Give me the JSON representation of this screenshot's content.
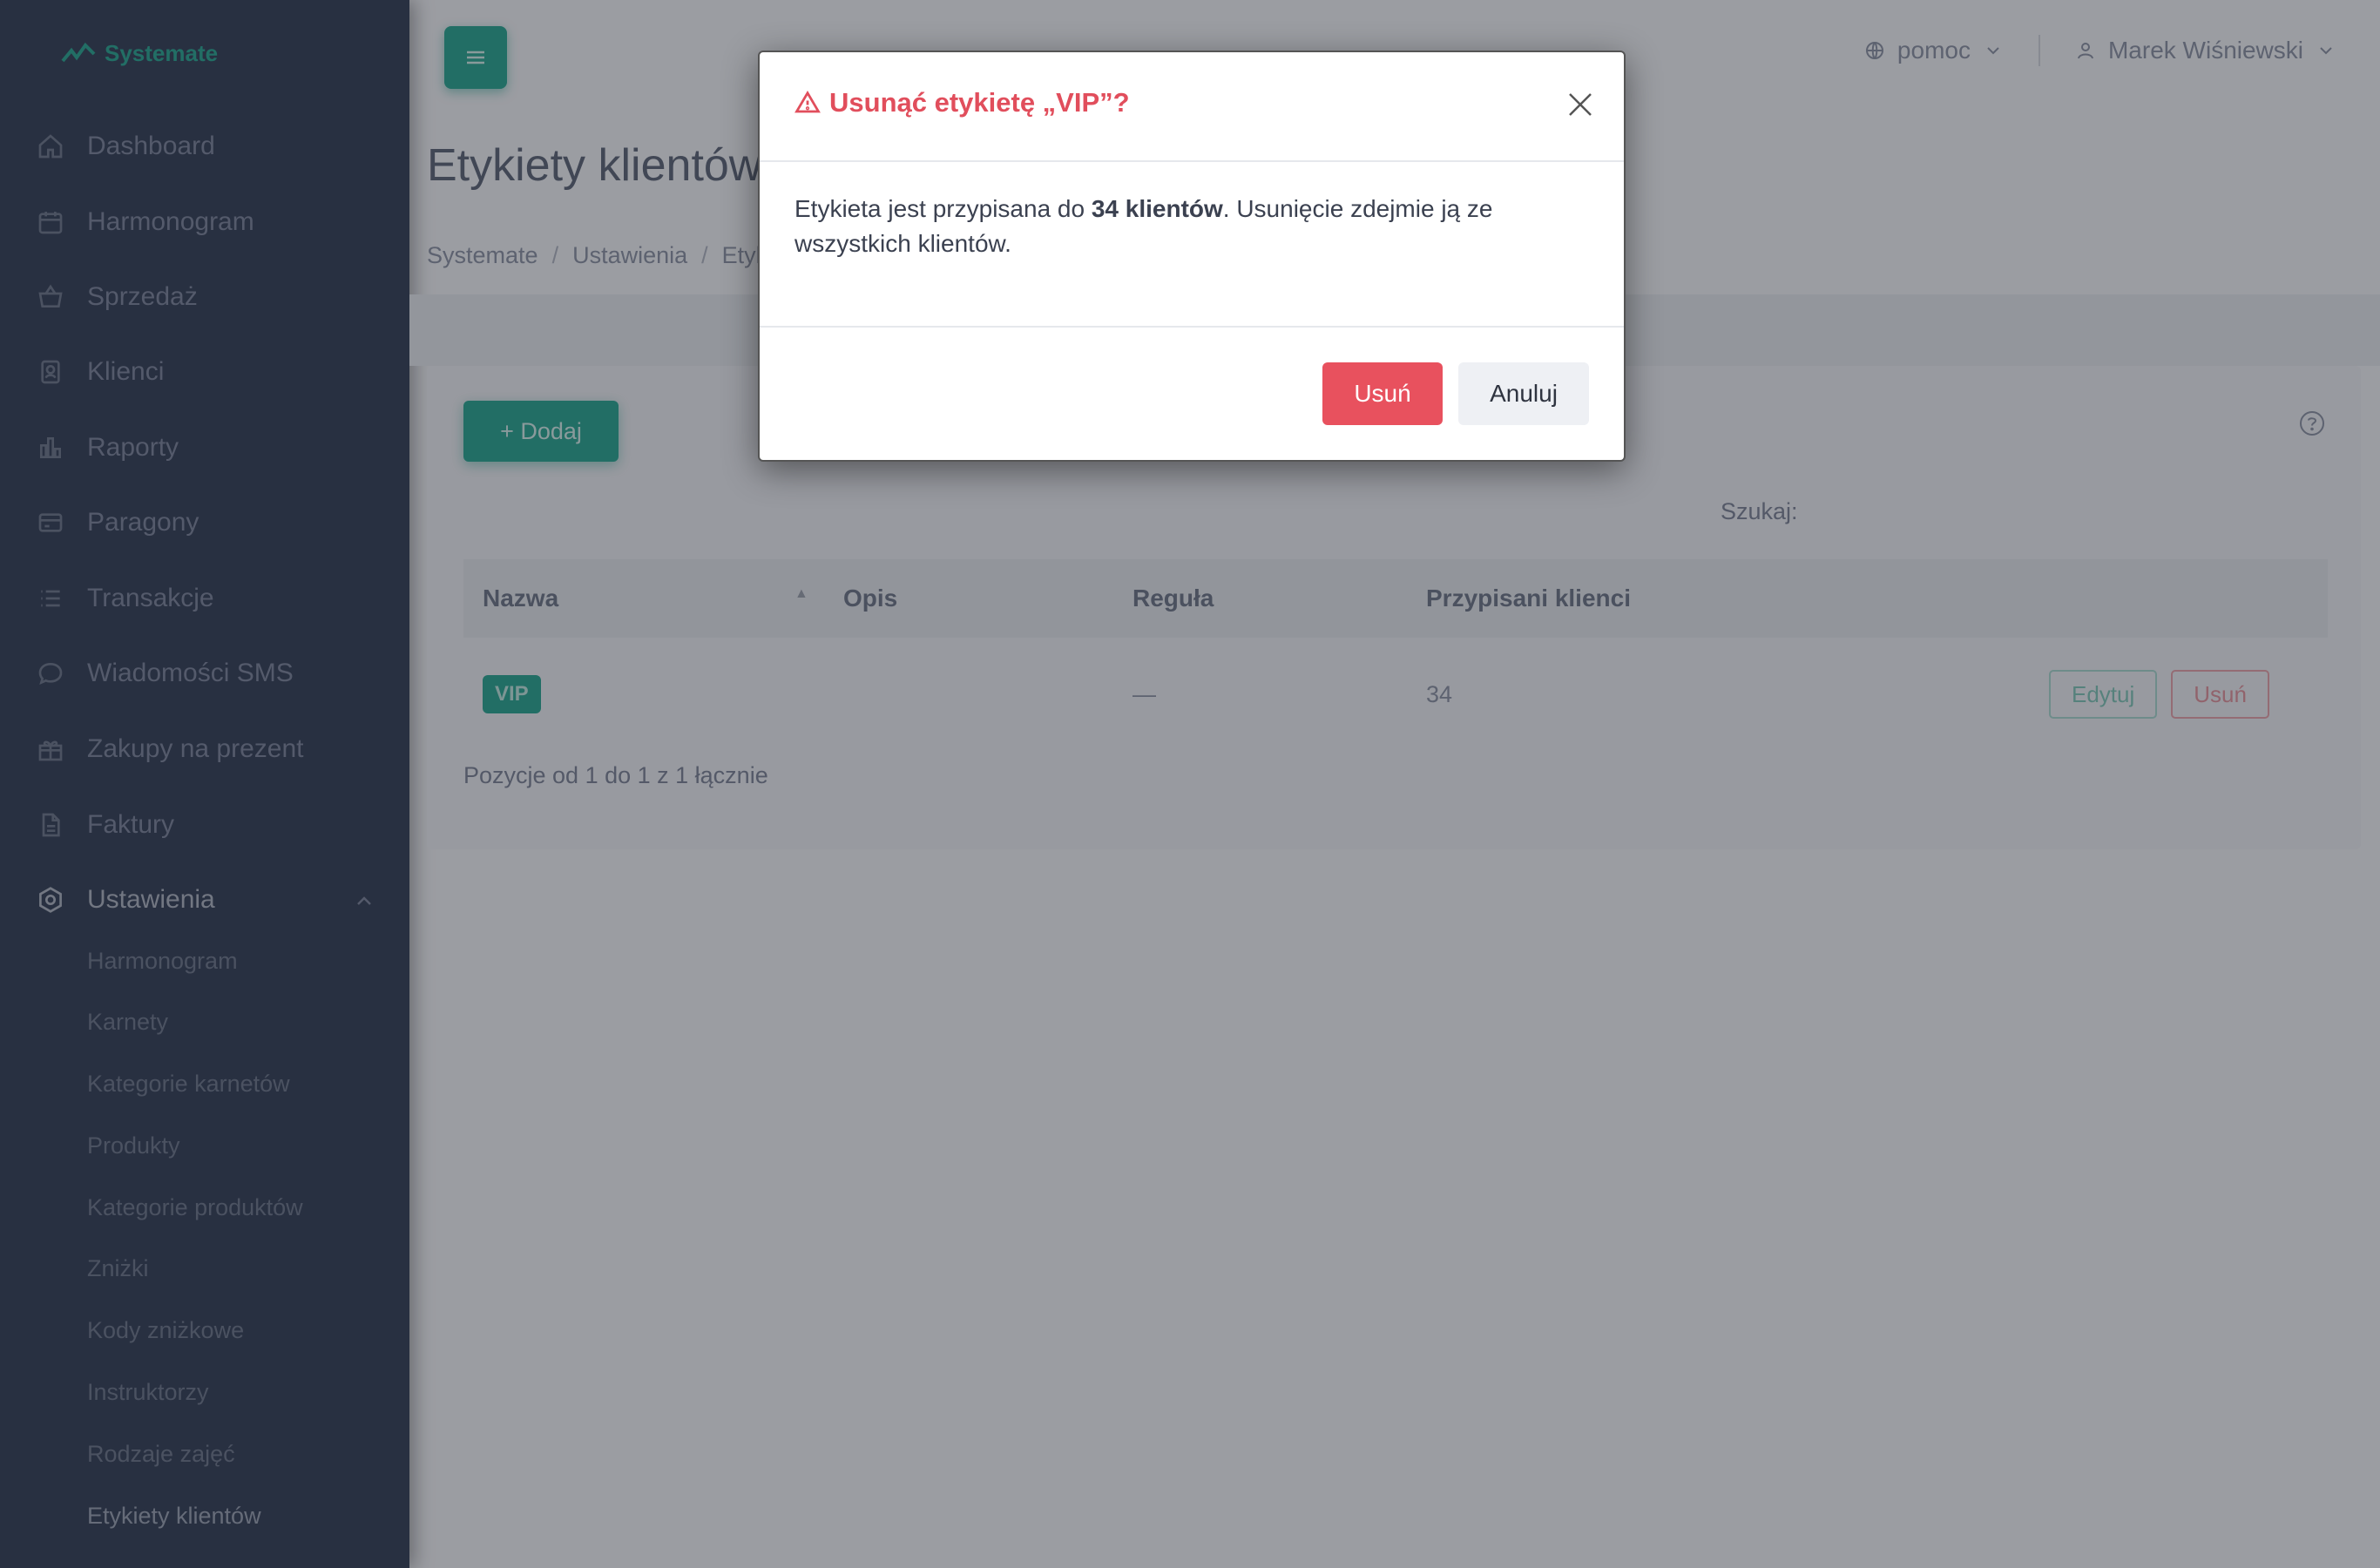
{
  "app": {
    "logo_text": "Systemate"
  },
  "sidebar": {
    "items": [
      {
        "label": "Dashboard",
        "icon": "home-icon"
      },
      {
        "label": "Harmonogram",
        "icon": "calendar-icon"
      },
      {
        "label": "Sprzedaż",
        "icon": "basket-icon"
      },
      {
        "label": "Klienci",
        "icon": "address-book-icon"
      },
      {
        "label": "Raporty",
        "icon": "bar-chart-icon"
      },
      {
        "label": "Paragony",
        "icon": "receipt-icon"
      },
      {
        "label": "Transakcje",
        "icon": "list-icon"
      },
      {
        "label": "Wiadomości SMS",
        "icon": "message-icon"
      },
      {
        "label": "Zakupy na prezent",
        "icon": "gift-icon"
      },
      {
        "label": "Faktury",
        "icon": "document-icon"
      },
      {
        "label": "Ustawienia",
        "icon": "gear-icon"
      }
    ],
    "settings_sub": [
      "Harmonogram",
      "Karnety",
      "Kategorie karnetów",
      "Produkty",
      "Kategorie produktów",
      "Zniżki",
      "Kody zniżkowe",
      "Instruktorzy",
      "Rodzaje zajęć",
      "Etykiety klientów"
    ]
  },
  "topbar": {
    "help_label": "pomoc",
    "user_name": "Marek Wiśniewski"
  },
  "page": {
    "title": "Etykiety klientów",
    "breadcrumb": [
      "Systemate",
      "Ustawienia",
      "Etykiety klientów"
    ]
  },
  "toolbar": {
    "add_label": "+ Dodaj",
    "search_label": "Szukaj:",
    "search_value": ""
  },
  "table": {
    "headers": [
      "Nazwa",
      "Opis",
      "Reguła",
      "Przypisani klienci"
    ],
    "rows": [
      {
        "name": "VIP",
        "description": "",
        "rule": "—",
        "assigned": "34",
        "edit_label": "Edytuj",
        "delete_label": "Usuń"
      }
    ],
    "info": "Pozycje od 1 do 1 z 1 łącznie"
  },
  "modal": {
    "title": "Usunąć etykietę „VIP”?",
    "body_prefix": "Etykieta jest przypisana do ",
    "body_bold": "34 klientów",
    "body_suffix": ". Usunięcie zdejmie ją ze wszystkich klientów.",
    "confirm_label": "Usuń",
    "cancel_label": "Anuluj"
  },
  "colors": {
    "brand": "#25a58f",
    "danger": "#e8515e",
    "sidebar_bg": "#303b52"
  }
}
